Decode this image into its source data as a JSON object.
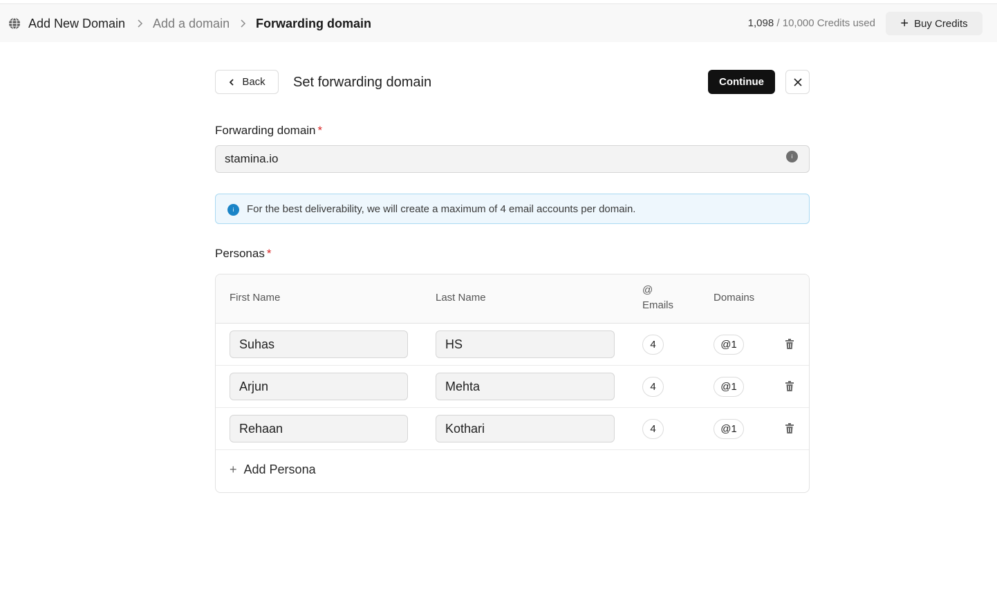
{
  "breadcrumb": {
    "root": "Add New Domain",
    "middle": "Add a domain",
    "current": "Forwarding domain"
  },
  "credits": {
    "used": "1,098",
    "separator": " / ",
    "total_text": "10,000 Credits used"
  },
  "buy_credits_label": "Buy Credits",
  "page": {
    "back_label": "Back",
    "title": "Set forwarding domain",
    "continue_label": "Continue"
  },
  "forwarding": {
    "label": "Forwarding domain",
    "required_mark": "*",
    "value": "stamina.io",
    "info_glyph": "i"
  },
  "notice": {
    "icon_glyph": "i",
    "text": "For the best deliverability, we will create a maximum of 4 email accounts per domain."
  },
  "personas": {
    "label": "Personas",
    "required_mark": "*",
    "columns": {
      "first_name": "First Name",
      "last_name": "Last Name",
      "emails_symbol": "@",
      "emails": "Emails",
      "domains": "Domains"
    },
    "rows": [
      {
        "first": "Suhas",
        "last": "HS",
        "emails": "4",
        "domains": "@1"
      },
      {
        "first": "Arjun",
        "last": "Mehta",
        "emails": "4",
        "domains": "@1"
      },
      {
        "first": "Rehaan",
        "last": "Kothari",
        "emails": "4",
        "domains": "@1"
      }
    ],
    "add_label": "Add Persona"
  },
  "icons": {
    "globe": "globe-icon",
    "chevron": "chevron-right-icon",
    "plus": "plus-icon",
    "back": "chevron-left-icon",
    "close": "close-icon",
    "info": "info-icon",
    "trash": "trash-icon"
  },
  "colors": {
    "primary_button": "#111111",
    "required": "#d92626",
    "notice_bg": "#eef7fd",
    "notice_border": "#a9d9f2",
    "info_blue": "#1a84c7"
  }
}
